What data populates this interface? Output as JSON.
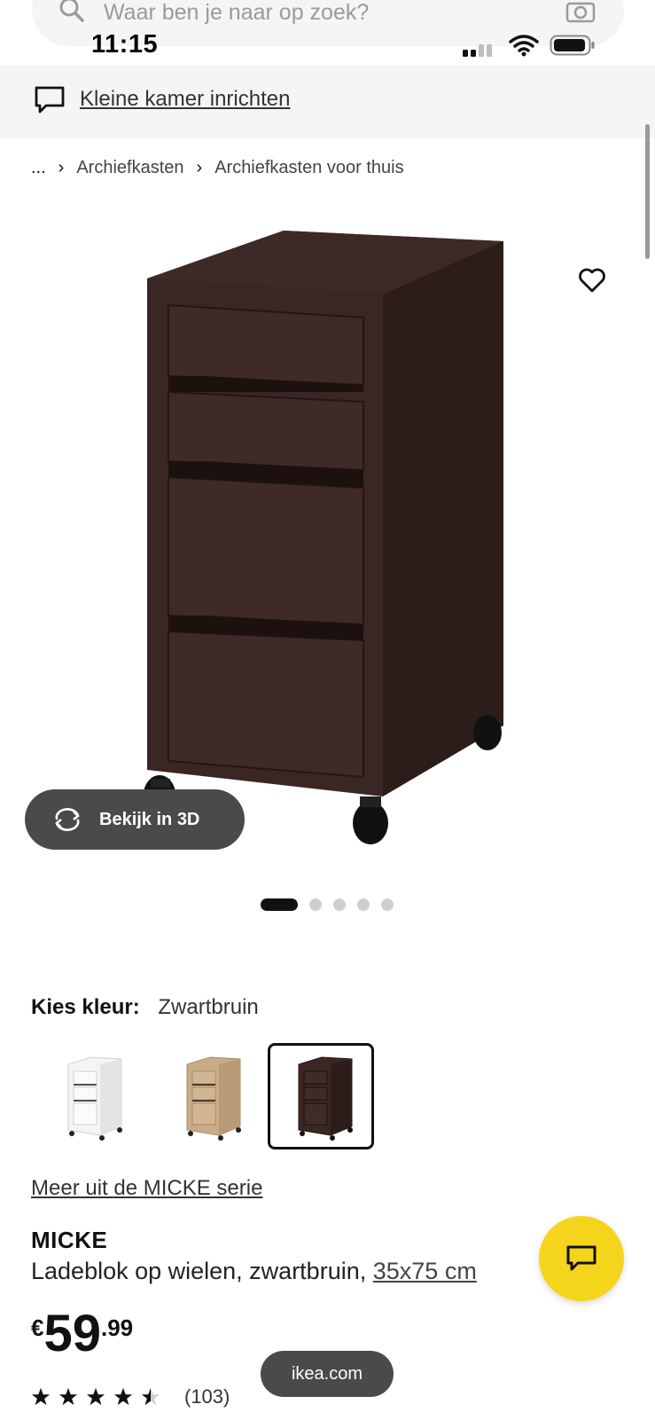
{
  "status_bar": {
    "time": "11:15"
  },
  "search": {
    "placeholder": "Waar ben je naar op zoek?"
  },
  "banner": {
    "link_text": "Kleine kamer inrichten"
  },
  "breadcrumb": {
    "ellipsis": "...",
    "items": [
      "Archiefkasten",
      "Archiefkasten voor thuis"
    ]
  },
  "product_gallery": {
    "view_3d_label": "Bekijk in 3D",
    "image_count": 5,
    "active_image_index": 0
  },
  "color_choice": {
    "label": "Kies kleur:",
    "selected_value": "Zwartbruin",
    "options": [
      {
        "name": "wit",
        "color": "#f2f2f2"
      },
      {
        "name": "eikeneffect",
        "color": "#c9ab86"
      },
      {
        "name": "zwartbruin",
        "color": "#3a2622"
      }
    ],
    "selected_index": 2
  },
  "series_link": "Meer uit de MICKE serie",
  "product": {
    "name": "MICKE",
    "description": "Ladeblok op wielen, zwartbruin,",
    "size_link": "35x75 cm",
    "price_currency": "€",
    "price_whole": "59",
    "price_cents": ".99",
    "rating": 4.5,
    "review_count": "(103)"
  },
  "url_pill": "ikea.com",
  "colors": {
    "accent_yellow": "#f5d51c",
    "dark_button": "#4a4a4a",
    "product_brown": "#3a2622"
  }
}
